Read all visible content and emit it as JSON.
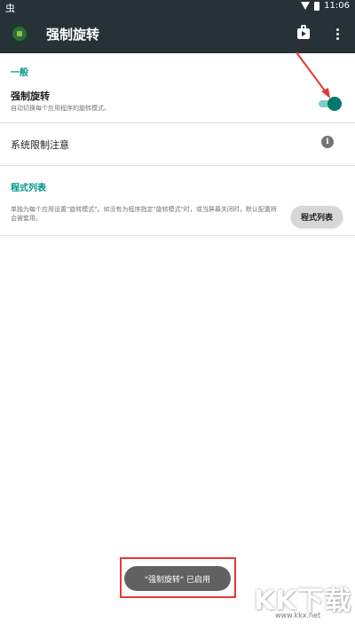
{
  "statusbar": {
    "left_icon": "虫",
    "time": "11:06"
  },
  "appbar": {
    "title": "强制旋转"
  },
  "sections": {
    "general": "一般",
    "force_rotation": {
      "title": "强制旋转",
      "subtitle": "自动切换每个应用程序的旋转模式。",
      "toggle_on": true
    },
    "system_limit": {
      "title": "系统限制注意"
    },
    "app_list": {
      "header": "程式列表",
      "description": "单独为每个应用设置\"旋转模式\"。如没有为程序指定\"旋转模式\"时，或当屏幕关闭时，默认配置将会被套用。",
      "button": "程式列表"
    }
  },
  "toast": {
    "text": "\"强制旋转\" 已启用"
  },
  "watermark": {
    "text": "KK下载",
    "url": "www.kkx.net"
  },
  "colors": {
    "appbar": "#263238",
    "accent": "#009688",
    "toast_bg": "#616161",
    "highlight": "#e53935"
  },
  "icons": [
    "app-icon",
    "shopping-bag-icon",
    "more-vert-icon",
    "info-icon",
    "wifi-icon",
    "battery-icon"
  ]
}
